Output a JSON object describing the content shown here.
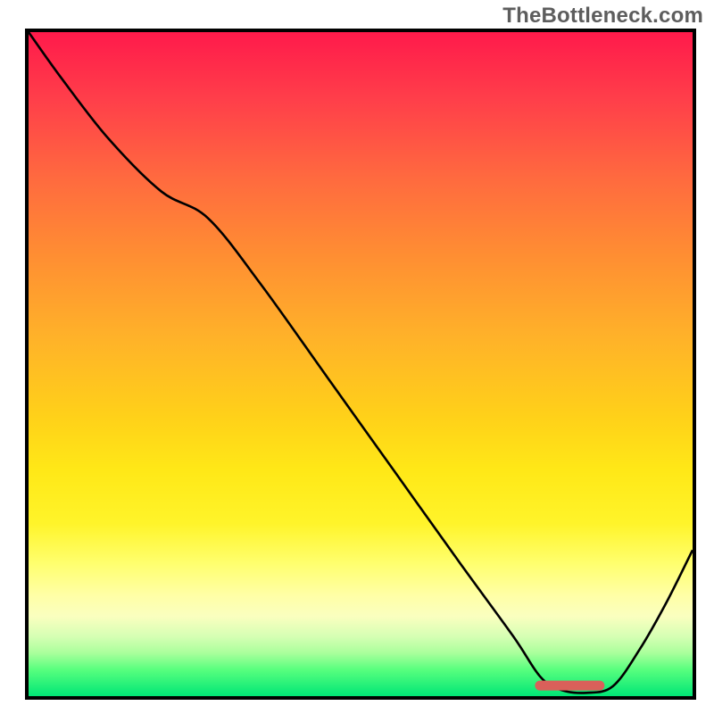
{
  "watermark": "TheBottleneck.com",
  "colors": {
    "curve": "#000000",
    "marker": "#d9605a"
  },
  "chart_data": {
    "type": "line",
    "title": "",
    "xlabel": "",
    "ylabel": "",
    "xlim": [
      0,
      100
    ],
    "ylim": [
      0,
      100
    ],
    "grid": false,
    "legend": false,
    "series": [
      {
        "name": "bottleneck-curve",
        "x": [
          0,
          5,
          12,
          20,
          27,
          35,
          45,
          55,
          65,
          73,
          77,
          80,
          84,
          88,
          92,
          96,
          100
        ],
        "y": [
          100,
          93,
          84,
          76,
          72,
          62,
          48,
          34,
          20,
          9,
          3,
          1,
          0.5,
          1.5,
          7,
          14,
          22
        ]
      }
    ],
    "marker": {
      "name": "optimal-range",
      "x_start": 77,
      "x_end": 86,
      "y": 1.6,
      "color": "#d9605a",
      "thickness": 11
    },
    "background_gradient_stops": [
      {
        "pos": 0,
        "color": "#ff1a4b"
      },
      {
        "pos": 0.1,
        "color": "#ff3e4a"
      },
      {
        "pos": 0.22,
        "color": "#ff6a3f"
      },
      {
        "pos": 0.33,
        "color": "#ff8c33"
      },
      {
        "pos": 0.46,
        "color": "#ffb229"
      },
      {
        "pos": 0.58,
        "color": "#ffd119"
      },
      {
        "pos": 0.66,
        "color": "#ffe817"
      },
      {
        "pos": 0.74,
        "color": "#fff42a"
      },
      {
        "pos": 0.8,
        "color": "#ffff6e"
      },
      {
        "pos": 0.85,
        "color": "#ffffa8"
      },
      {
        "pos": 0.88,
        "color": "#faffbf"
      },
      {
        "pos": 0.91,
        "color": "#d6ffb4"
      },
      {
        "pos": 0.935,
        "color": "#aaff9c"
      },
      {
        "pos": 0.96,
        "color": "#58ff7e"
      },
      {
        "pos": 1.0,
        "color": "#00e676"
      }
    ]
  }
}
